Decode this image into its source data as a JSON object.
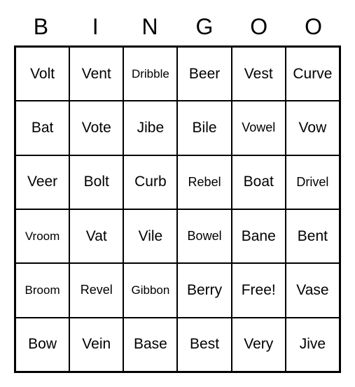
{
  "header": [
    "B",
    "I",
    "N",
    "G",
    "O",
    "O"
  ],
  "grid": [
    [
      "Volt",
      "Vent",
      "Dribble",
      "Beer",
      "Vest",
      "Curve"
    ],
    [
      "Bat",
      "Vote",
      "Jibe",
      "Bile",
      "Vowel",
      "Vow"
    ],
    [
      "Veer",
      "Bolt",
      "Curb",
      "Rebel",
      "Boat",
      "Drivel"
    ],
    [
      "Vroom",
      "Vat",
      "Vile",
      "Bowel",
      "Bane",
      "Bent"
    ],
    [
      "Broom",
      "Revel",
      "Gibbon",
      "Berry",
      "Free!",
      "Vase"
    ],
    [
      "Bow",
      "Vein",
      "Base",
      "Best",
      "Very",
      "Jive"
    ]
  ]
}
